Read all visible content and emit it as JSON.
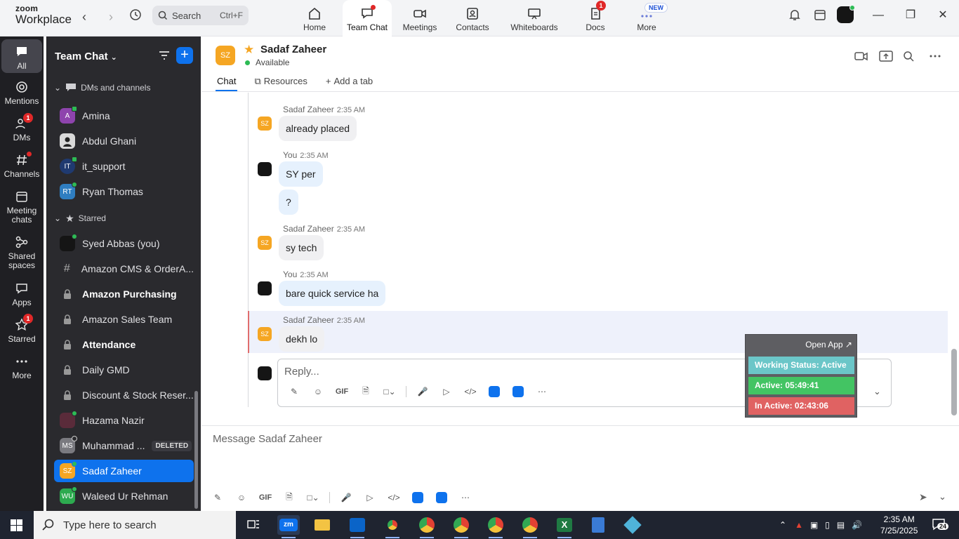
{
  "app": {
    "brand_line1": "zoom",
    "brand_line2": "Workplace"
  },
  "topbar": {
    "search_label": "Search",
    "search_shortcut": "Ctrl+F",
    "tabs": [
      {
        "label": "Home",
        "icon": "home-icon"
      },
      {
        "label": "Team Chat",
        "icon": "chat-icon",
        "dot": true
      },
      {
        "label": "Meetings",
        "icon": "camera-icon"
      },
      {
        "label": "Contacts",
        "icon": "contacts-icon"
      },
      {
        "label": "Whiteboards",
        "icon": "whiteboard-icon"
      },
      {
        "label": "Docs",
        "icon": "docs-icon",
        "badge": "1"
      },
      {
        "label": "More",
        "icon": "more-icon",
        "new": "NEW"
      }
    ]
  },
  "rail": {
    "items": [
      {
        "label": "All",
        "icon": "chat-bubble-icon"
      },
      {
        "label": "Mentions",
        "icon": "at-icon"
      },
      {
        "label": "DMs",
        "icon": "people-icon",
        "badge": "1"
      },
      {
        "label": "Channels",
        "icon": "hash-icon"
      },
      {
        "label_line1": "Meeting",
        "label_line2": "chats",
        "icon": "calendar-icon"
      },
      {
        "label_line1": "Shared",
        "label_line2": "spaces",
        "icon": "share-icon"
      },
      {
        "label": "Apps",
        "icon": "apps-icon"
      },
      {
        "label": "Starred",
        "icon": "star-icon",
        "badge": "1"
      },
      {
        "label": "More",
        "icon": "ellipsis-icon"
      }
    ]
  },
  "sidebar": {
    "title": "Team Chat",
    "section_dms": "DMs and channels",
    "section_starred": "Starred",
    "dms": [
      {
        "name": "Amina",
        "initials": "A",
        "color": "#8e44ad"
      },
      {
        "name": "Abdul Ghani",
        "initials": "",
        "color": "#555555"
      },
      {
        "name": "it_support",
        "initials": "IT",
        "color": "#1f3a70"
      },
      {
        "name": "Ryan Thomas",
        "initials": "RT",
        "color": "#2f7ec1"
      }
    ],
    "starred": [
      {
        "name": "Syed Abbas (you)",
        "type": "user"
      },
      {
        "name": "Amazon CMS & OrderA...",
        "type": "channel"
      },
      {
        "name": "Amazon Purchasing",
        "type": "locked",
        "bold": true
      },
      {
        "name": "Amazon Sales Team",
        "type": "locked"
      },
      {
        "name": "Attendance",
        "type": "locked",
        "bold": true
      },
      {
        "name": "Daily GMD",
        "type": "locked"
      },
      {
        "name": "Discount & Stock Reser...",
        "type": "locked"
      },
      {
        "name": "Hazama Nazir",
        "type": "user"
      },
      {
        "name": "Muhammad ...",
        "type": "user",
        "initials": "MS",
        "tag": "DELETED"
      },
      {
        "name": "Sadaf Zaheer",
        "type": "user",
        "initials": "SZ",
        "selected": true
      },
      {
        "name": "Waleed Ur Rehman",
        "type": "user",
        "initials": "WU"
      }
    ]
  },
  "chat": {
    "contact_name": "Sadaf Zaheer",
    "contact_initials": "SZ",
    "status": "Available",
    "tabs": [
      "Chat",
      "Resources",
      "Add a tab"
    ],
    "messages": [
      {
        "sender": "Sadaf Zaheer",
        "time": "2:35 AM",
        "text": "already placed"
      },
      {
        "sender": "You",
        "time": "2:35 AM",
        "text": "SY per"
      },
      {
        "sender": "",
        "time": "",
        "text": "?"
      },
      {
        "sender": "Sadaf Zaheer",
        "time": "2:35 AM",
        "text": "sy tech"
      },
      {
        "sender": "You",
        "time": "2:35 AM",
        "text": "bare quick service ha"
      },
      {
        "sender": "Sadaf Zaheer",
        "time": "2:35 AM",
        "text": "dekh lo"
      }
    ],
    "reply_placeholder": "Reply...",
    "composer_placeholder": "Message Sadaf Zaheer",
    "gif_label": "GIF"
  },
  "widget": {
    "open_app": "Open App ↗",
    "working_status": "Working Status: Active",
    "active": "Active: 05:49:41",
    "inactive": "In Active: 02:43:06"
  },
  "taskbar": {
    "search_placeholder": "Type here to search",
    "time": "2:35 AM",
    "date": "7/25/2025",
    "notif_count": "24"
  }
}
